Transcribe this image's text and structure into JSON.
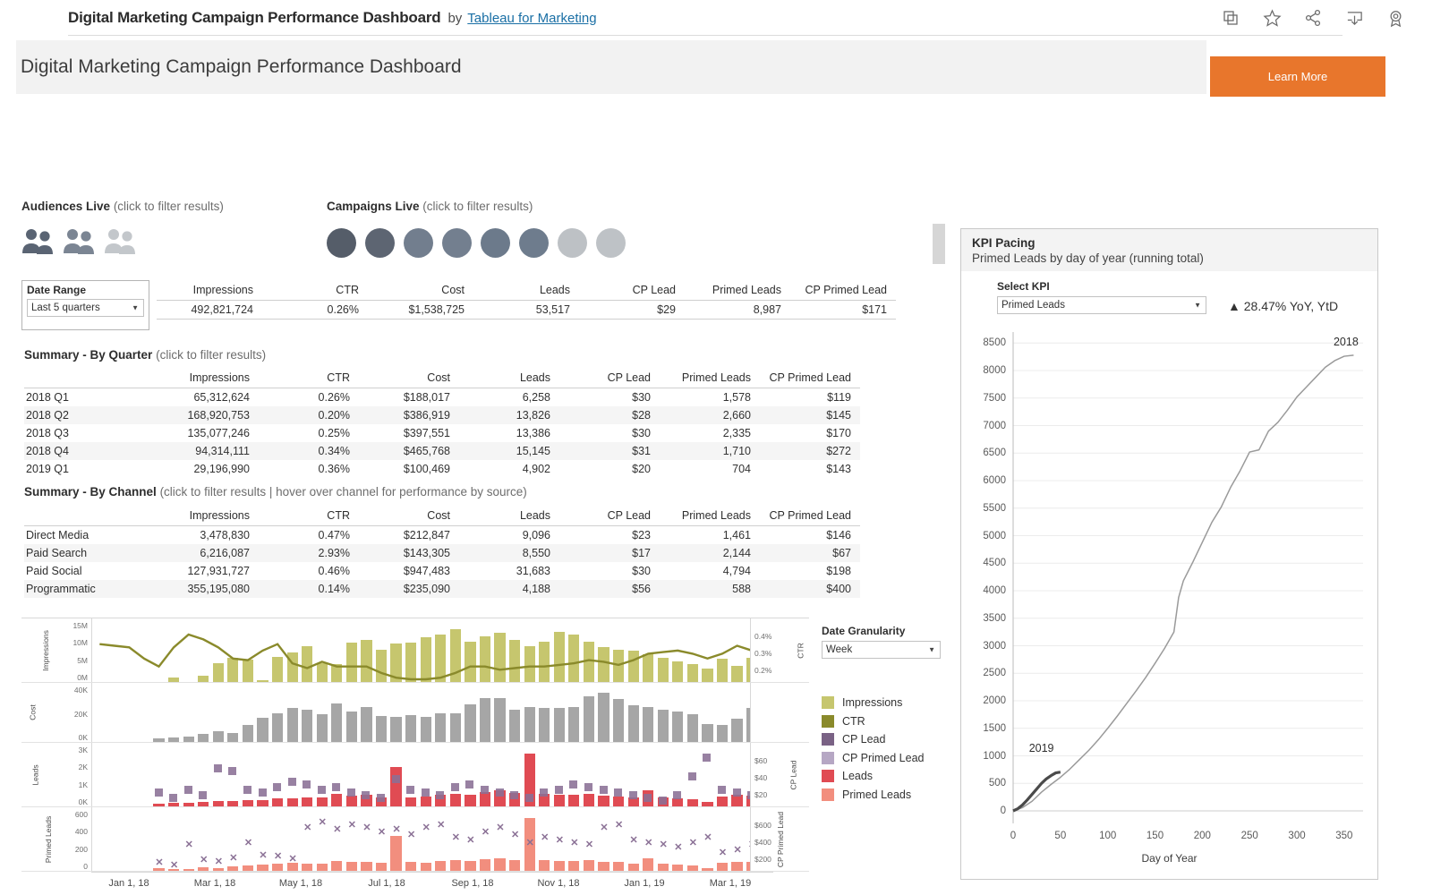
{
  "topbar": {
    "title": "Digital Marketing Campaign Performance Dashboard",
    "by": "by",
    "author": "Tableau for Marketing",
    "icons": [
      "copy-icon",
      "star-icon",
      "share-icon",
      "download-icon",
      "badge-icon"
    ]
  },
  "header": {
    "title": "Digital Marketing Campaign Performance Dashboard",
    "learn_more": "Learn More",
    "learn_more_color": "#E8762C"
  },
  "filters": {
    "audiences_label": "Audiences Live",
    "audiences_hint": "(click to filter results)",
    "audiences_colors": [
      "#5a6473",
      "#7b8593",
      "#c3c7cb"
    ],
    "campaigns_label": "Campaigns Live",
    "campaigns_hint": "(click to filter results)",
    "campaigns_colors": [
      "#555d69",
      "#5d6572",
      "#727e8e",
      "#737f8f",
      "#6c7a8b",
      "#6e7c8d",
      "#bdc1c5",
      "#bec2c6"
    ],
    "date_range_label": "Date Range",
    "date_range_value": "Last 5 quarters"
  },
  "kpi_summary": {
    "columns": [
      "Impressions",
      "CTR",
      "Cost",
      "Leads",
      "CP Lead",
      "Primed Leads",
      "CP Primed Lead"
    ],
    "values": [
      "492,821,724",
      "0.26%",
      "$1,538,725",
      "53,517",
      "$29",
      "8,987",
      "$171"
    ]
  },
  "quarter_table": {
    "label": "Summary - By Quarter",
    "hint": "(click to filter results)",
    "columns": [
      "Impressions",
      "CTR",
      "Cost",
      "Leads",
      "CP Lead",
      "Primed Leads",
      "CP Primed Lead"
    ],
    "rows": [
      {
        "name": "2018 Q1",
        "cells": [
          "65,312,624",
          "0.26%",
          "$188,017",
          "6,258",
          "$30",
          "1,578",
          "$119"
        ]
      },
      {
        "name": "2018 Q2",
        "cells": [
          "168,920,753",
          "0.20%",
          "$386,919",
          "13,826",
          "$28",
          "2,660",
          "$145"
        ]
      },
      {
        "name": "2018 Q3",
        "cells": [
          "135,077,246",
          "0.25%",
          "$397,551",
          "13,386",
          "$30",
          "2,335",
          "$170"
        ]
      },
      {
        "name": "2018 Q4",
        "cells": [
          "94,314,111",
          "0.34%",
          "$465,768",
          "15,145",
          "$31",
          "1,710",
          "$272"
        ]
      },
      {
        "name": "2019 Q1",
        "cells": [
          "29,196,990",
          "0.36%",
          "$100,469",
          "4,902",
          "$20",
          "704",
          "$143"
        ]
      }
    ]
  },
  "channel_table": {
    "label": "Summary - By Channel",
    "hint": "(click to filter results | hover over channel for performance by source)",
    "columns": [
      "Impressions",
      "CTR",
      "Cost",
      "Leads",
      "CP Lead",
      "Primed Leads",
      "CP Primed Lead"
    ],
    "rows": [
      {
        "name": "Direct Media",
        "cells": [
          "3,478,830",
          "0.47%",
          "$212,847",
          "9,096",
          "$23",
          "1,461",
          "$146"
        ]
      },
      {
        "name": "Paid Search",
        "cells": [
          "6,216,087",
          "2.93%",
          "$143,305",
          "8,550",
          "$17",
          "2,144",
          "$67"
        ]
      },
      {
        "name": "Paid Social",
        "cells": [
          "127,931,727",
          "0.46%",
          "$947,483",
          "31,683",
          "$30",
          "4,794",
          "$198"
        ]
      },
      {
        "name": "Programmatic",
        "cells": [
          "355,195,080",
          "0.14%",
          "$235,090",
          "4,188",
          "$56",
          "588",
          "$400"
        ]
      }
    ]
  },
  "granularity": {
    "label": "Date Granularity",
    "value": "Week"
  },
  "legend": {
    "items": [
      {
        "label": "Impressions",
        "color": "#c6c66e"
      },
      {
        "label": "CTR",
        "color": "#8a8a2b"
      },
      {
        "label": "CP Lead",
        "color": "#7a6285"
      },
      {
        "label": "CP Primed Lead",
        "color": "#b6a7c4"
      },
      {
        "label": "Leads",
        "color": "#e04b53"
      },
      {
        "label": "Primed Leads",
        "color": "#f28e7e"
      }
    ]
  },
  "kpi_panel": {
    "title": "KPI Pacing",
    "subtitle": "Primed Leads by day of year (running total)",
    "select_label": "Select KPI",
    "select_value": "Primed Leads",
    "delta": "▲ 28.47% YoY, YtD"
  },
  "chart_data": [
    {
      "type": "line",
      "name": "kpi-pacing",
      "title": "KPI Pacing",
      "subtitle": "Primed Leads by day of year (running total)",
      "xlabel": "Day of Year",
      "ylabel": "",
      "xlim": [
        0,
        370
      ],
      "ylim": [
        0,
        8700
      ],
      "xticks": [
        0,
        50,
        100,
        150,
        200,
        250,
        300,
        350
      ],
      "yticks": [
        0,
        500,
        1000,
        1500,
        2000,
        2500,
        3000,
        3500,
        4000,
        4500,
        5000,
        5500,
        6000,
        6500,
        7000,
        7500,
        8000,
        8500
      ],
      "grid": true,
      "legend": "annotations",
      "annotations": [
        {
          "text": "2018",
          "x": 352,
          "y": 8280
        },
        {
          "text": "2019",
          "x": 30,
          "y": 900
        }
      ],
      "series": [
        {
          "name": "2018",
          "color": "#9a9a9a",
          "x": [
            0,
            10,
            20,
            30,
            40,
            50,
            60,
            70,
            80,
            90,
            100,
            110,
            120,
            130,
            140,
            150,
            160,
            170,
            175,
            180,
            190,
            200,
            210,
            220,
            230,
            240,
            250,
            260,
            270,
            280,
            290,
            300,
            310,
            320,
            330,
            340,
            350,
            360
          ],
          "y": [
            0,
            60,
            175,
            340,
            480,
            610,
            760,
            930,
            1100,
            1290,
            1500,
            1720,
            1950,
            2180,
            2420,
            2680,
            2950,
            3250,
            3880,
            4180,
            4520,
            4880,
            5240,
            5520,
            5880,
            6180,
            6520,
            6560,
            6900,
            7060,
            7280,
            7520,
            7700,
            7880,
            8060,
            8180,
            8260,
            8280
          ]
        },
        {
          "name": "2019",
          "color": "#4a4a4a",
          "x": [
            0,
            5,
            10,
            15,
            20,
            25,
            30,
            35,
            40,
            45,
            50
          ],
          "y": [
            0,
            40,
            110,
            200,
            300,
            400,
            500,
            580,
            640,
            690,
            704
          ]
        }
      ]
    },
    {
      "type": "bar",
      "name": "impressions-ctr",
      "ylabel": "Impressions",
      "y2label": "CTR",
      "yticks": [
        "0M",
        "5M",
        "10M",
        "15M"
      ],
      "y2ticks": [
        "0.2%",
        "0.3%",
        "0.4%"
      ],
      "bar_color": "#c6c66e",
      "line_color": "#8a8a2b",
      "bars": [
        0,
        0,
        0,
        0,
        0,
        0.8,
        0,
        1.1,
        3.6,
        4.6,
        4.2,
        0.3,
        4.7,
        5.6,
        6.8,
        3.6,
        3.4,
        7.4,
        7.9,
        6.1,
        7.3,
        7.4,
        8.4,
        8.9,
        10.0,
        7.6,
        8.6,
        9.2,
        8.0,
        6.7,
        7.6,
        9.4,
        8.9,
        7.6,
        6.6,
        6.1,
        5.9,
        5.2,
        4.6,
        3.9,
        3.4,
        2.6,
        4.4,
        3.1,
        4.5,
        3.7
      ],
      "line": [
        0.345,
        0.34,
        0.335,
        0.3,
        0.275,
        0.335,
        0.375,
        0.36,
        0.335,
        0.3,
        0.295,
        0.325,
        0.345,
        0.285,
        0.27,
        0.29,
        0.275,
        0.275,
        0.275,
        0.255,
        0.24,
        0.235,
        0.235,
        0.24,
        0.255,
        0.275,
        0.275,
        0.265,
        0.27,
        0.275,
        0.275,
        0.28,
        0.285,
        0.295,
        0.29,
        0.28,
        0.295,
        0.315,
        0.32,
        0.325,
        0.315,
        0.3,
        0.315,
        0.34,
        0.325,
        0.31
      ]
    },
    {
      "type": "bar",
      "name": "cost",
      "ylabel": "Cost",
      "yticks": [
        "0K",
        "20K",
        "40K"
      ],
      "bar_color": "#a6a6a6",
      "bars": [
        0,
        0,
        0,
        0,
        2.5,
        3.2,
        3.8,
        5.5,
        6.8,
        6.0,
        11.0,
        16.0,
        18.5,
        22.0,
        21.0,
        18.0,
        25.0,
        20.0,
        23.0,
        17.0,
        16.5,
        17.5,
        16.5,
        19.0,
        18.5,
        24.5,
        29.0,
        28.5,
        21.0,
        23.0,
        22.0,
        22.0,
        23.0,
        30.0,
        32.0,
        28.0,
        24.0,
        23.0,
        21.0,
        20.0,
        18.0,
        12.0,
        11.0,
        15.5,
        22.0,
        20.0
      ]
    },
    {
      "type": "bar",
      "name": "leads-cplead",
      "ylabel": "Leads",
      "y2label": "CP Lead",
      "yticks": [
        "0K",
        "1K",
        "2K",
        "3K"
      ],
      "y2ticks": [
        "$20",
        "$40",
        "$60"
      ],
      "bar_color": "#e04b53",
      "marker_color": "#8a7095",
      "bars": [
        0,
        0,
        0,
        0,
        0.15,
        0.18,
        0.16,
        0.2,
        0.28,
        0.25,
        0.3,
        0.32,
        0.38,
        0.4,
        0.45,
        0.42,
        0.6,
        0.52,
        0.55,
        0.45,
        1.95,
        0.45,
        0.48,
        0.55,
        0.6,
        0.55,
        0.7,
        0.8,
        0.65,
        2.6,
        0.62,
        0.58,
        0.55,
        0.6,
        0.52,
        0.5,
        0.45,
        0.8,
        0.42,
        0.4,
        0.35,
        0.2,
        0.48,
        0.55,
        0.52,
        0.5
      ],
      "markers": [
        null,
        null,
        null,
        null,
        28,
        24,
        30,
        26,
        46,
        44,
        30,
        28,
        32,
        36,
        34,
        30,
        32,
        28,
        26,
        24,
        38,
        30,
        28,
        26,
        32,
        34,
        30,
        28,
        26,
        24,
        28,
        30,
        34,
        32,
        30,
        28,
        26,
        24,
        22,
        26,
        40,
        54,
        30,
        28,
        26,
        24
      ]
    },
    {
      "type": "bar",
      "name": "primedleads-cpprimed",
      "ylabel": "Primed Leads",
      "y2label": "CP Primed Lead",
      "yticks": [
        "0",
        "200",
        "400",
        "600"
      ],
      "y2ticks": [
        "$200",
        "$400",
        "$600"
      ],
      "bar_color": "#f28e7e",
      "marker_color": "#8a7095",
      "bars": [
        0,
        0,
        0,
        0,
        30,
        28,
        25,
        45,
        40,
        60,
        70,
        85,
        90,
        110,
        100,
        95,
        130,
        120,
        115,
        105,
        460,
        120,
        110,
        135,
        140,
        130,
        150,
        165,
        140,
        700,
        145,
        130,
        125,
        140,
        120,
        115,
        100,
        170,
        90,
        85,
        75,
        40,
        105,
        120,
        115,
        110
      ],
      "markers": [
        null,
        null,
        null,
        null,
        160,
        150,
        230,
        170,
        165,
        180,
        240,
        190,
        185,
        175,
        300,
        320,
        290,
        310,
        300,
        280,
        290,
        270,
        300,
        310,
        260,
        250,
        280,
        300,
        270,
        240,
        260,
        250,
        240,
        230,
        300,
        310,
        250,
        240,
        230,
        220,
        240,
        260,
        200,
        210,
        230,
        320
      ]
    }
  ],
  "ts_xaxis": {
    "labels": [
      "Jan 1, 18",
      "Mar 1, 18",
      "May 1, 18",
      "Jul 1, 18",
      "Sep 1, 18",
      "Nov 1, 18",
      "Jan 1, 19",
      "Mar 1, 19"
    ]
  }
}
